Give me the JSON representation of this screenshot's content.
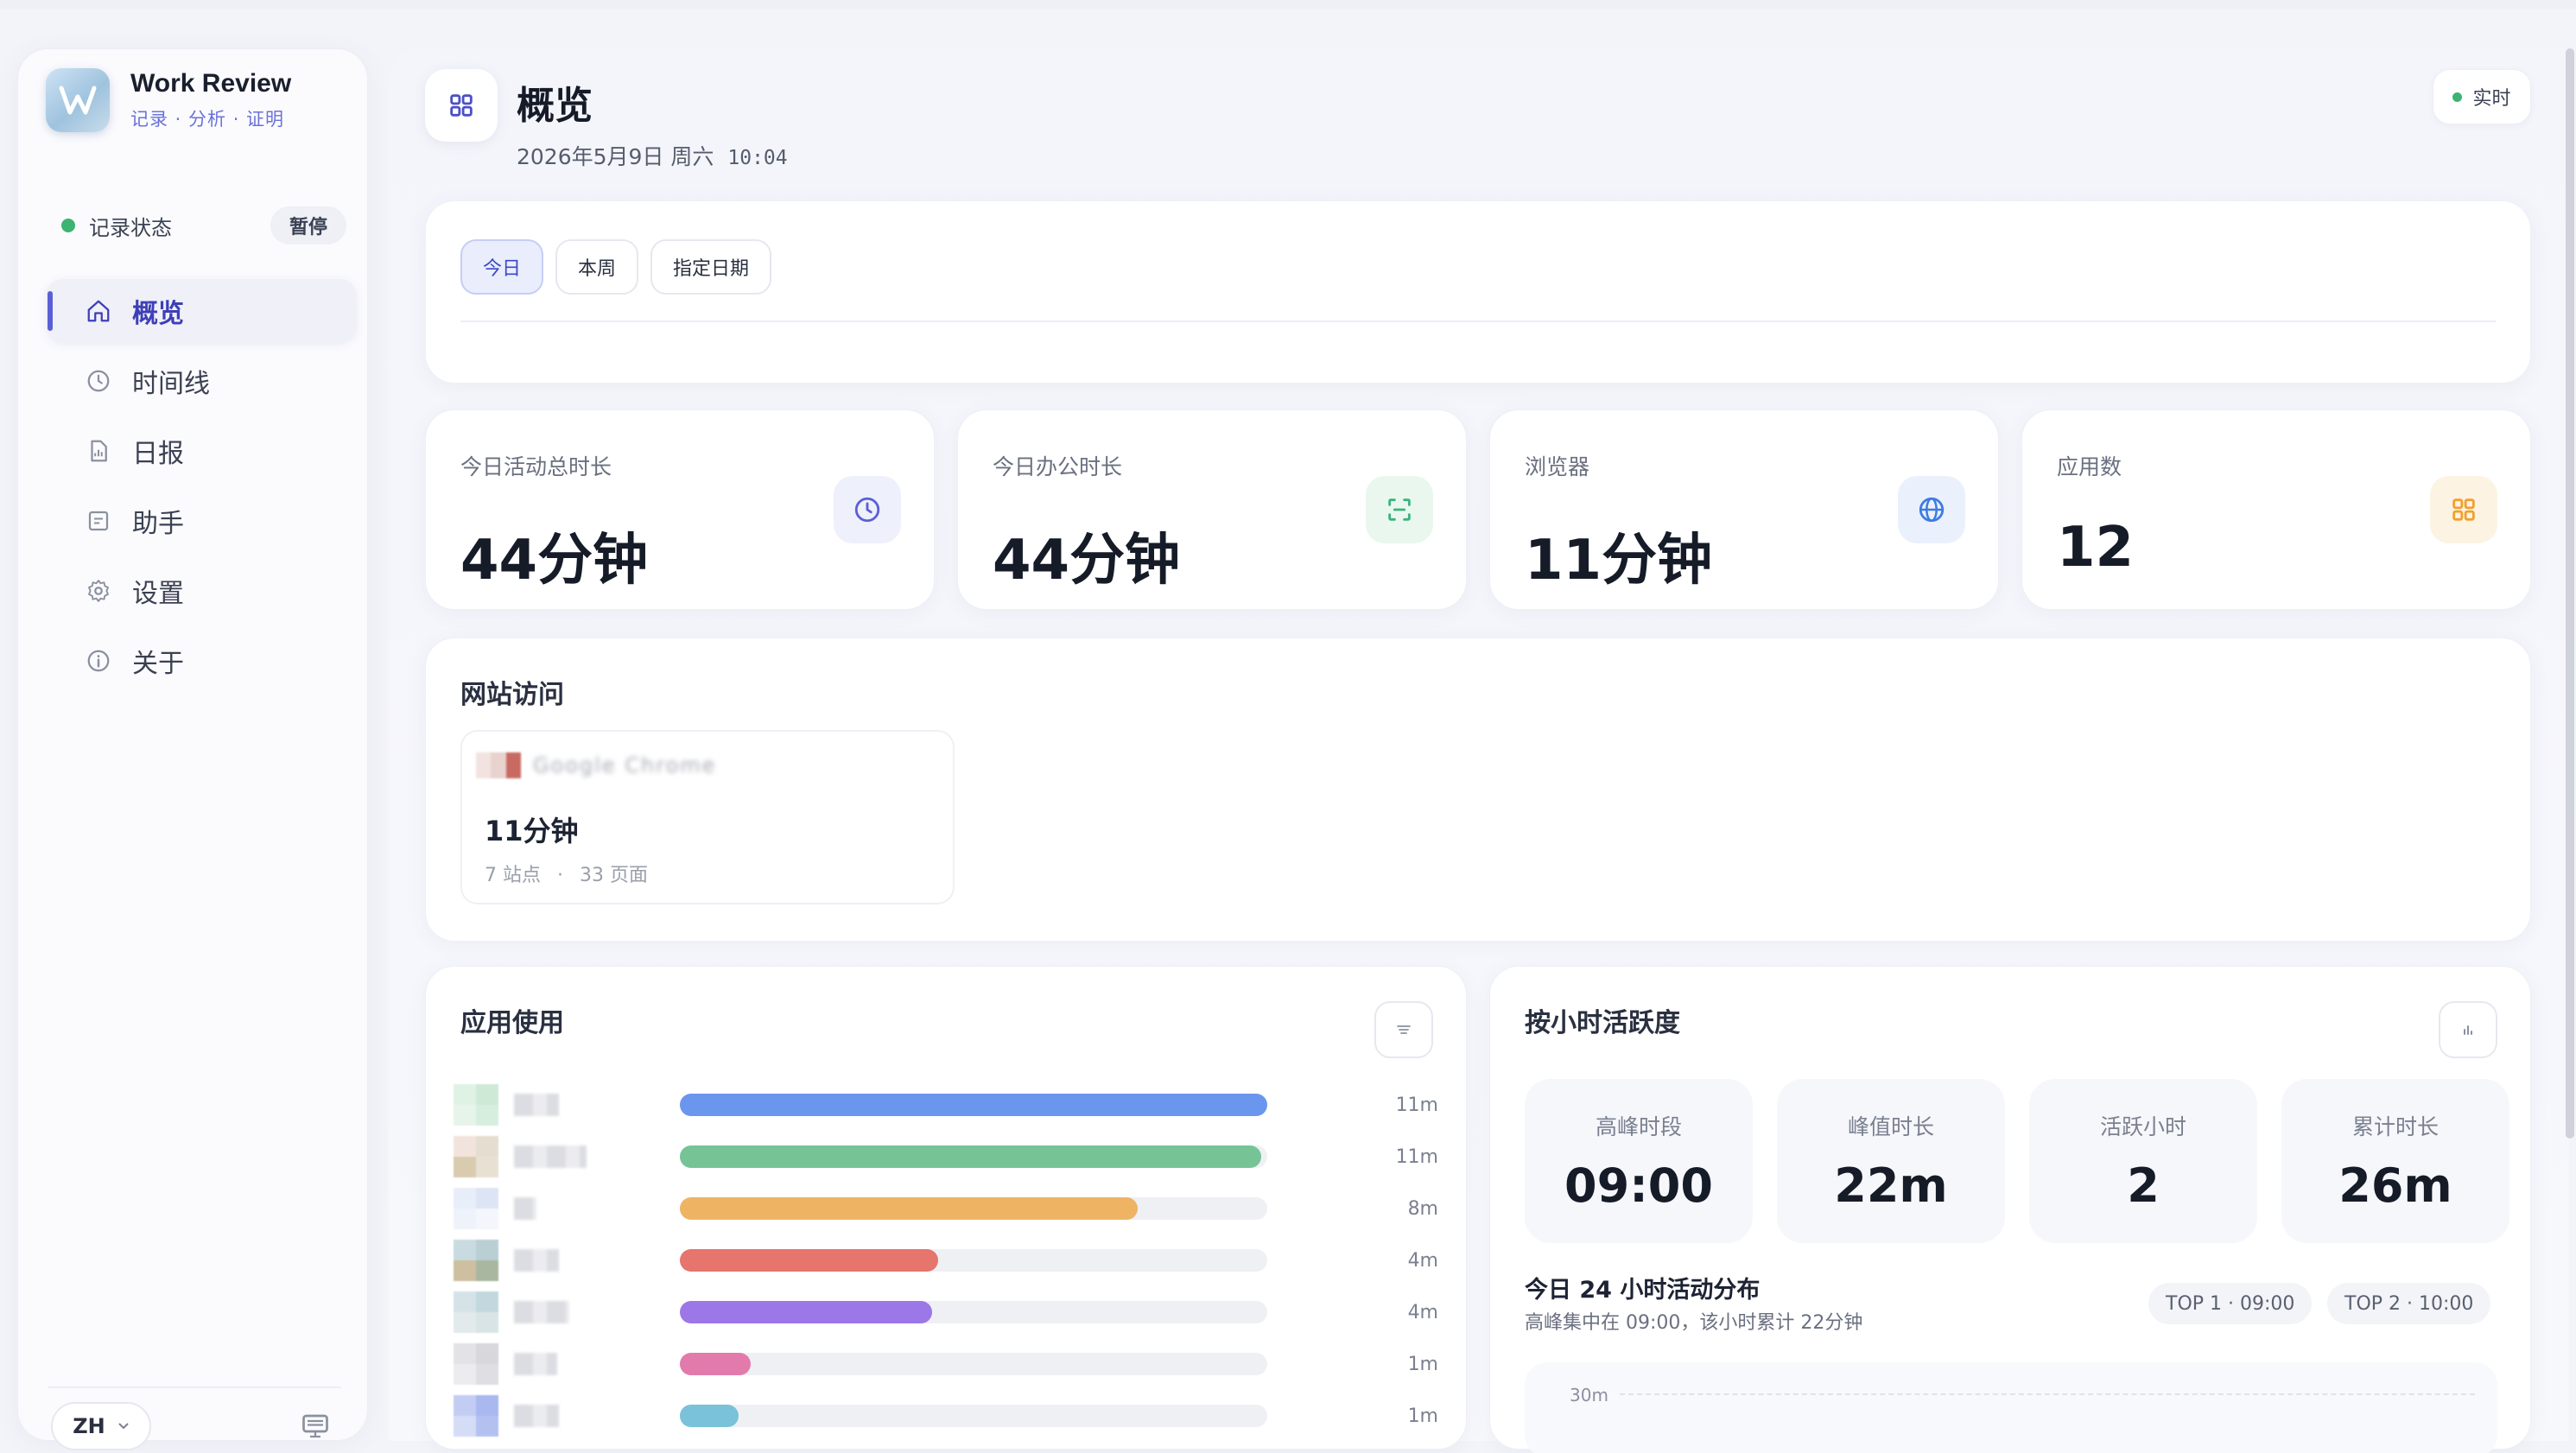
{
  "app": {
    "name": "Work Review",
    "tagline": "记录 · 分析 · 证明"
  },
  "status": {
    "label": "记录状态",
    "action": "暂停"
  },
  "nav": [
    {
      "label": "概览",
      "icon": "home-icon",
      "active": true
    },
    {
      "label": "时间线",
      "icon": "clock-icon",
      "active": false
    },
    {
      "label": "日报",
      "icon": "report-icon",
      "active": false
    },
    {
      "label": "助手",
      "icon": "assistant-icon",
      "active": false
    },
    {
      "label": "设置",
      "icon": "gear-icon",
      "active": false
    },
    {
      "label": "关于",
      "icon": "info-icon",
      "active": false
    }
  ],
  "language": "ZH",
  "header": {
    "title": "概览",
    "date": "2026年5月9日 周六",
    "time": "10:04",
    "realtime": "实时"
  },
  "tabs": [
    "今日",
    "本周",
    "指定日期"
  ],
  "stats": [
    {
      "label": "今日活动总时长",
      "value": "44分钟",
      "icon": "clock-icon",
      "color": "#6b6fd8"
    },
    {
      "label": "今日办公时长",
      "value": "44分钟",
      "icon": "scan-icon",
      "color": "#3cb37a"
    },
    {
      "label": "浏览器",
      "value": "11分钟",
      "icon": "globe-icon",
      "color": "#3f7be0"
    },
    {
      "label": "应用数",
      "value": "12",
      "icon": "grid-icon",
      "color": "#f0a030"
    }
  ],
  "sites": {
    "title": "网站访问",
    "browser": {
      "name": "Google Chrome",
      "time": "11分钟",
      "sites": "7 站点",
      "separator": "·",
      "pages": "33 页面"
    }
  },
  "apps": {
    "title": "应用使用",
    "rows": [
      {
        "value": "11m",
        "fraction": 1.0,
        "color": "#6b96ee"
      },
      {
        "value": "11m",
        "fraction": 0.99,
        "color": "#76c496"
      },
      {
        "value": "8m",
        "fraction": 0.78,
        "color": "#eeb464"
      },
      {
        "value": "4m",
        "fraction": 0.44,
        "color": "#e5756d"
      },
      {
        "value": "4m",
        "fraction": 0.43,
        "color": "#9b77e8"
      },
      {
        "value": "1m",
        "fraction": 0.12,
        "color": "#e27aac"
      },
      {
        "value": "1m",
        "fraction": 0.1,
        "color": "#79c2d9"
      }
    ]
  },
  "hours": {
    "title": "按小时活跃度",
    "kpis": [
      {
        "label": "高峰时段",
        "value": "09:00"
      },
      {
        "label": "峰值时长",
        "value": "22m"
      },
      {
        "label": "活跃小时",
        "value": "2"
      },
      {
        "label": "累计时长",
        "value": "26m"
      }
    ],
    "dist_title": "今日 24 小时活动分布",
    "dist_sub": "高峰集中在 09:00，该小时累计 22分钟",
    "top1": "TOP 1 · 09:00",
    "top2": "TOP 2 · 10:00",
    "grid_label": "30m"
  }
}
